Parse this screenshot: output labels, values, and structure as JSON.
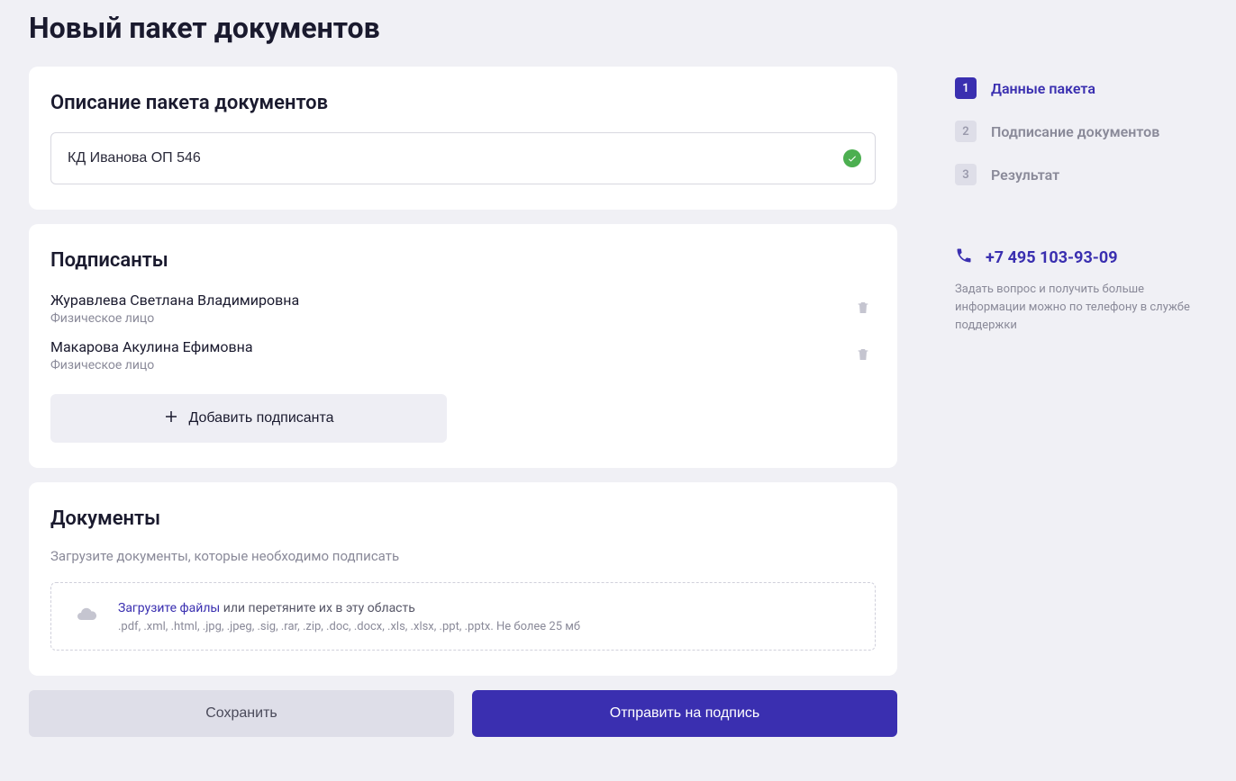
{
  "page": {
    "title": "Новый пакет документов"
  },
  "description": {
    "title": "Описание пакета документов",
    "value": "КД Иванова ОП 546"
  },
  "signers": {
    "title": "Подписанты",
    "items": [
      {
        "name": "Журавлева Светлана Владимировна",
        "type": "Физическое лицо"
      },
      {
        "name": "Макарова Акулина Ефимовна",
        "type": "Физическое лицо"
      }
    ],
    "add_label": "Добавить подписанта"
  },
  "documents": {
    "title": "Документы",
    "subtitle": "Загрузите документы, которые необходимо подписать",
    "upload_link": "Загрузите файлы",
    "upload_rest": " или перетяните их в эту область",
    "hint": ".pdf, .xml, .html, .jpg, .jpeg, .sig, .rar, .zip, .doc, .docx, .xls, .xlsx, .ppt, .pptx. Не более 25 мб"
  },
  "footer": {
    "save": "Сохранить",
    "submit": "Отправить на подпись"
  },
  "steps": [
    {
      "num": "1",
      "label": "Данные пакета",
      "active": true
    },
    {
      "num": "2",
      "label": "Подписание документов",
      "active": false
    },
    {
      "num": "3",
      "label": "Результат",
      "active": false
    }
  ],
  "support": {
    "phone": "+7 495 103-93-09",
    "text": "Задать вопрос и получить больше информации можно по телефону в службе поддержки"
  }
}
